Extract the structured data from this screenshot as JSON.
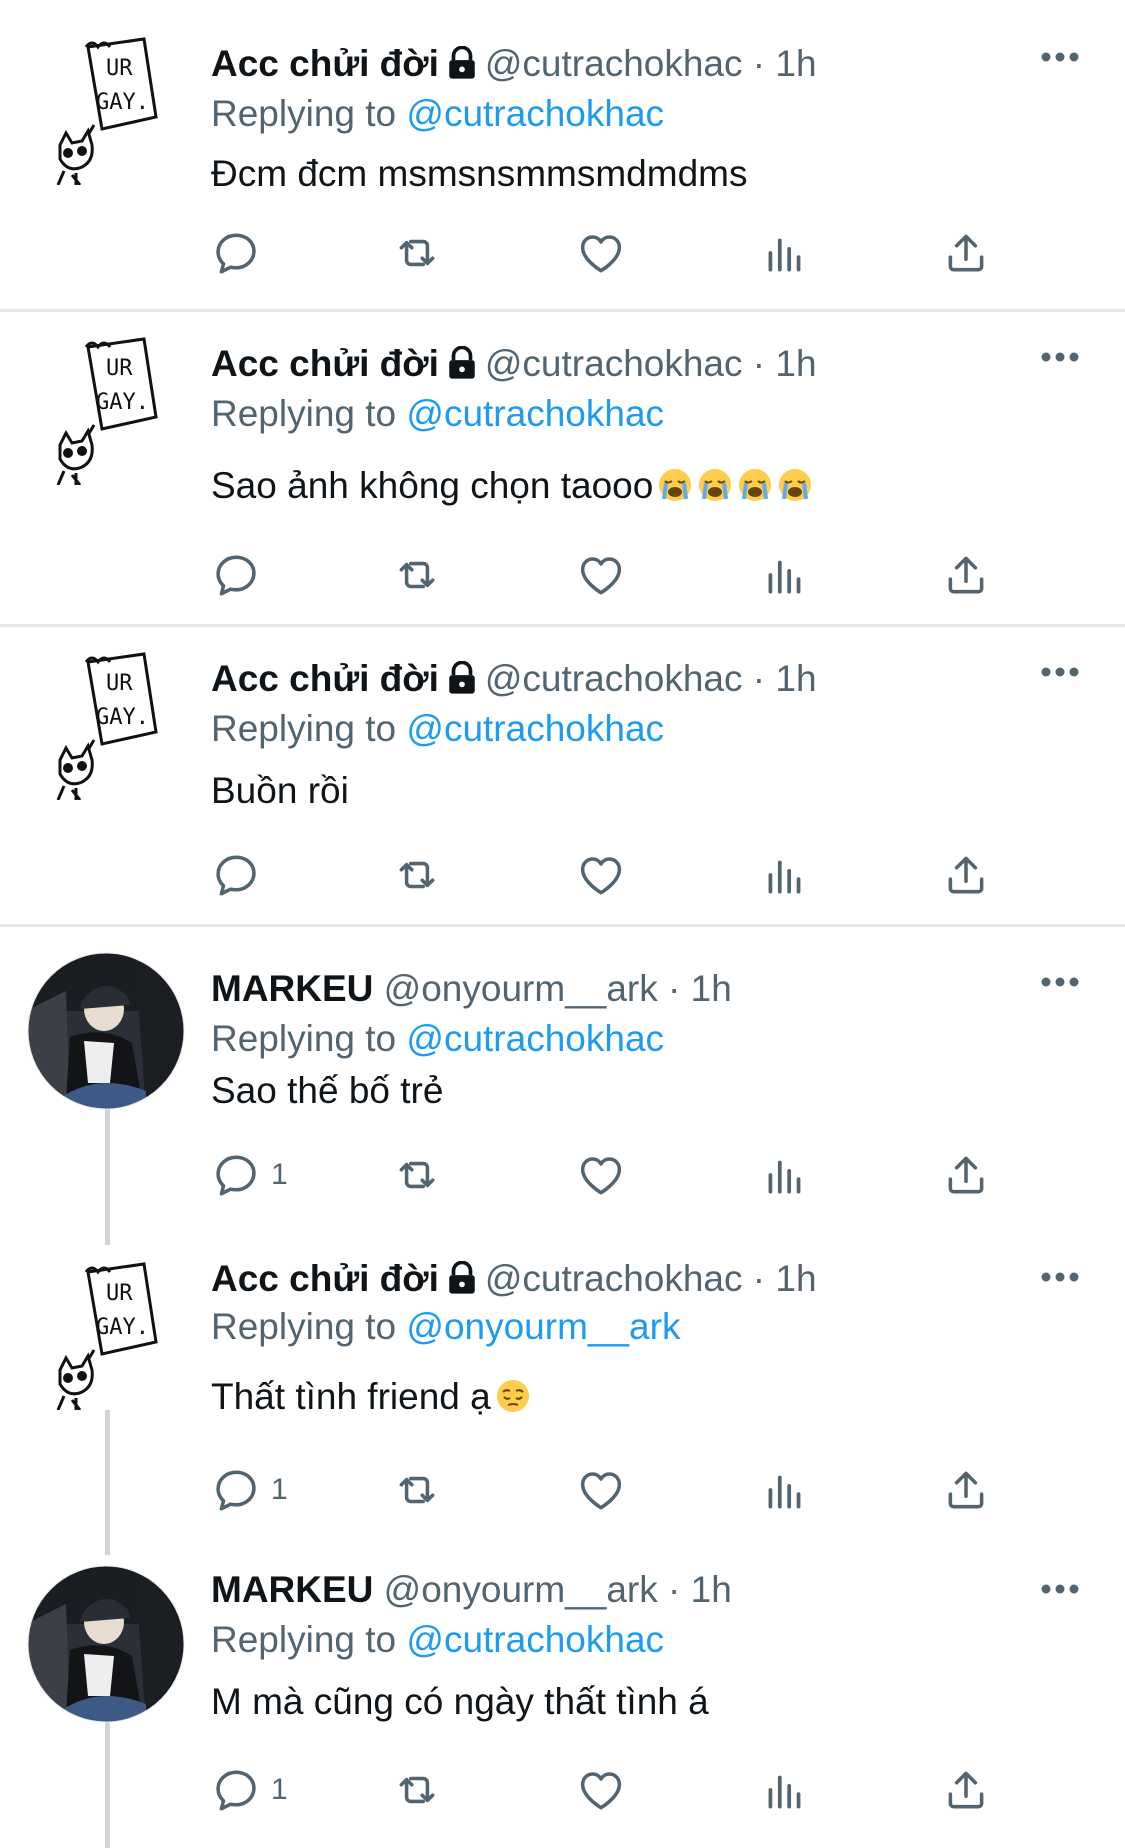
{
  "tweets": [
    {
      "author": "Acc chửi đời",
      "handle": "@cutrachokhac",
      "dot": "·",
      "time": "1h",
      "replying_label": "Replying to",
      "replying_to": "@cutrachokhac",
      "text": "Đcm đcm msmsnsmmsmdmdms",
      "reply_count": "",
      "emoji": []
    },
    {
      "author": "Acc chửi đời",
      "handle": "@cutrachokhac",
      "dot": "·",
      "time": "1h",
      "replying_label": "Replying to",
      "replying_to": "@cutrachokhac",
      "text": "Sao ảnh không chọn taooo",
      "reply_count": "",
      "emoji": [
        "loudly-crying-face",
        "loudly-crying-face",
        "loudly-crying-face",
        "loudly-crying-face"
      ]
    },
    {
      "author": "Acc chửi đời",
      "handle": "@cutrachokhac",
      "dot": "·",
      "time": "1h",
      "replying_label": "Replying to",
      "replying_to": "@cutrachokhac",
      "text": "Buồn rồi",
      "reply_count": "",
      "emoji": []
    },
    {
      "author": "MARKEU",
      "handle": "@onyourm__ark",
      "dot": "·",
      "time": "1h",
      "replying_label": "Replying to",
      "replying_to": "@cutrachokhac",
      "text": "Sao thế bố trẻ",
      "reply_count": "1",
      "emoji": []
    },
    {
      "author": "Acc chửi đời",
      "handle": "@cutrachokhac",
      "dot": "·",
      "time": "1h",
      "replying_label": "Replying to",
      "replying_to": "@onyourm__ark",
      "text": "Thất tình friend ạ",
      "reply_count": "1",
      "emoji": [
        "pensive-face"
      ]
    },
    {
      "author": "MARKEU",
      "handle": "@onyourm__ark",
      "dot": "·",
      "time": "1h",
      "replying_label": "Replying to",
      "replying_to": "@cutrachokhac",
      "text": "M mà cũng có ngày thất tình á",
      "reply_count": "1",
      "emoji": []
    }
  ],
  "avatar_doodle_text": [
    "UR",
    "GAY."
  ],
  "colors": {
    "text_primary": "#0f1419",
    "text_secondary": "#536471",
    "link": "#1d9bf0",
    "divider": "#e3e6e9",
    "thread_line": "#cfd4d8"
  }
}
